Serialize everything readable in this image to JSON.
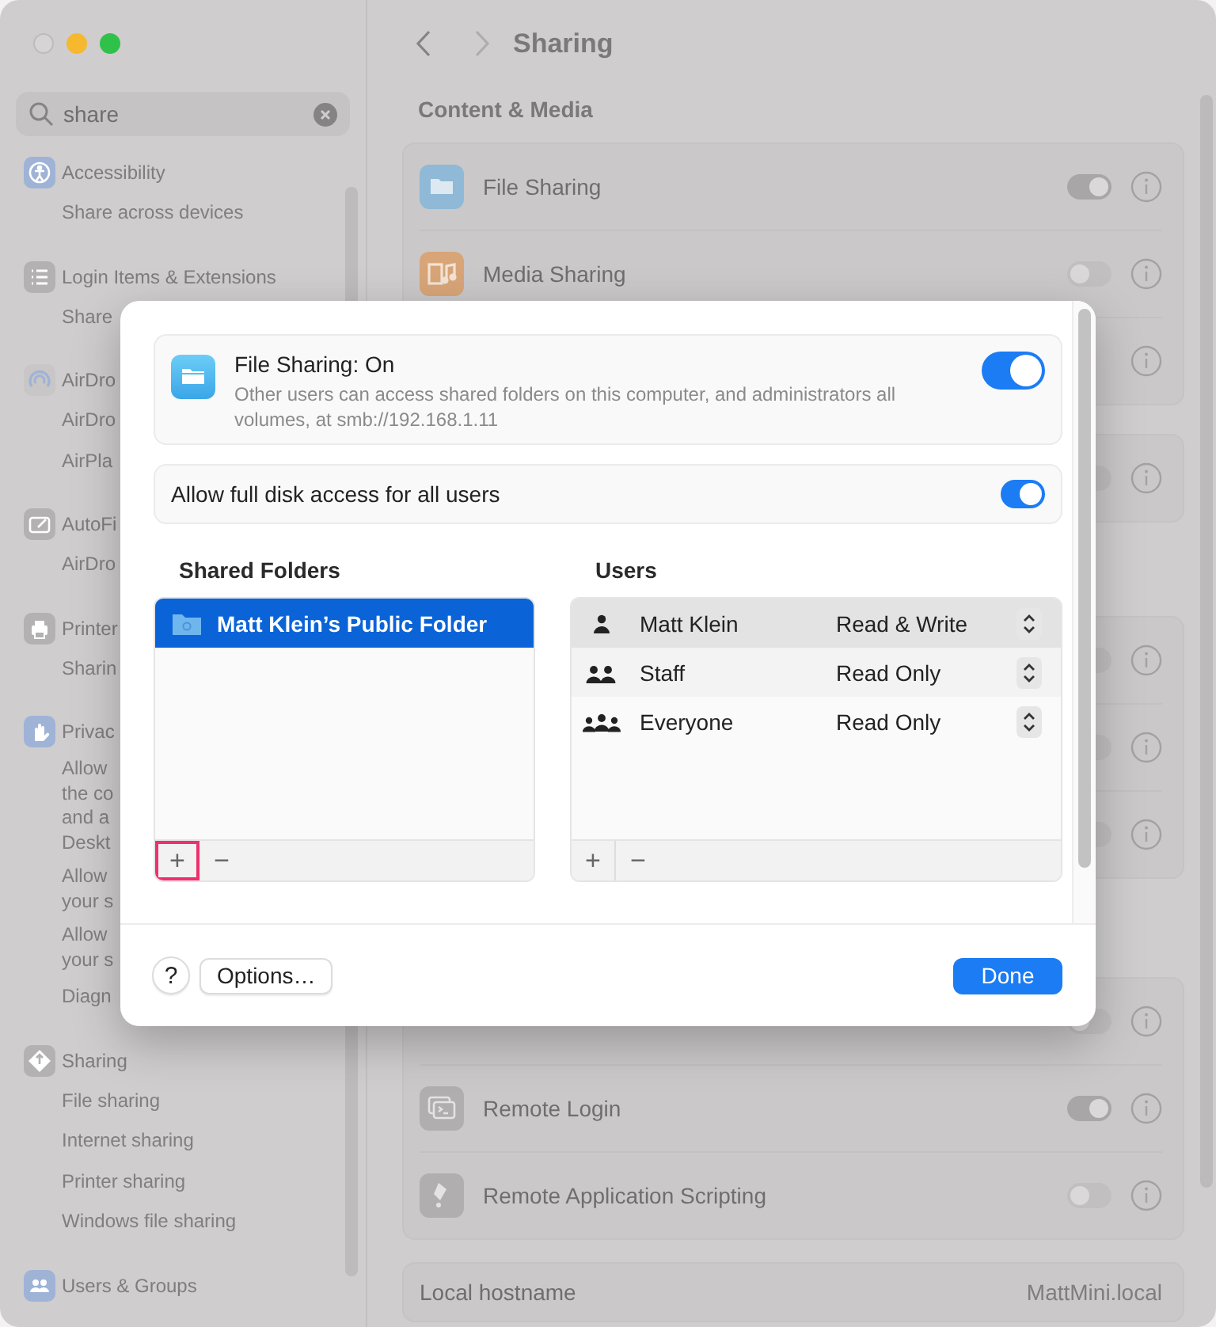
{
  "sidebar": {
    "search": {
      "value": "share"
    },
    "groups": [
      {
        "title": "Accessibility",
        "kind": "accessibility",
        "items": [
          "Share across devices"
        ]
      },
      {
        "title": "Login Items & Extensions",
        "kind": "list",
        "items": [
          "Share"
        ]
      },
      {
        "title": "AirDro",
        "kind": "airdrop",
        "items": [
          "AirDro",
          "AirPla"
        ]
      },
      {
        "title": "AutoFi",
        "kind": "autofill",
        "items": [
          "AirDro"
        ]
      },
      {
        "title": "Printer",
        "kind": "printer",
        "items": [
          "Sharin"
        ]
      },
      {
        "title": "Privac",
        "kind": "privacy",
        "items": [
          "Allow\nthe co\nand a\nDeskt",
          "Allow\nyour s",
          "Allow\nyour s",
          "Diagn"
        ]
      },
      {
        "title": "Sharing",
        "kind": "sharing",
        "items": [
          "File sharing",
          "Internet sharing",
          "Printer sharing",
          "Windows file sharing"
        ]
      },
      {
        "title": "Users & Groups",
        "kind": "users"
      }
    ]
  },
  "header": {
    "title": "Sharing"
  },
  "content": {
    "section": "Content & Media",
    "cards": [
      {
        "rows": [
          {
            "label": "File Sharing",
            "kind": "folder",
            "on": true
          },
          {
            "label": "Media Sharing",
            "kind": "music",
            "on": false
          },
          {}
        ]
      },
      {
        "rows": [
          {
            "on": false
          }
        ]
      },
      {
        "rows": [
          {
            "on": false
          },
          {
            "on": false
          },
          {
            "on": false
          }
        ]
      },
      {
        "rows": [
          {
            "on": false
          },
          {
            "label": "Remote Login",
            "kind": "terminal",
            "on": true
          },
          {
            "label": "Remote Application Scripting",
            "kind": "script",
            "on": false
          }
        ]
      }
    ],
    "hostname": {
      "label": "Local hostname",
      "value": "MattMini.local"
    }
  },
  "sheet": {
    "status": {
      "title": "File Sharing: On",
      "description": "Other users can access shared folders on this computer, and administrators all volumes, at smb://192.168.1.11",
      "on": true
    },
    "full_disk": {
      "label": "Allow full disk access for all users",
      "on": true
    },
    "shared_folders": {
      "heading": "Shared Folders",
      "items": [
        {
          "name": "Matt Klein’s Public Folder",
          "selected": true
        }
      ],
      "add": "+",
      "remove": "−",
      "add_highlighted": true
    },
    "users": {
      "heading": "Users",
      "items": [
        {
          "name": "Matt Klein",
          "kind": "single",
          "permission": "Read & Write",
          "selected": true
        },
        {
          "name": "Staff",
          "kind": "pair",
          "permission": "Read Only",
          "selected": false
        },
        {
          "name": "Everyone",
          "kind": "group",
          "permission": "Read Only",
          "selected": false
        }
      ],
      "add": "+",
      "remove": "−"
    },
    "help": "?",
    "options": "Options…",
    "done": "Done"
  }
}
